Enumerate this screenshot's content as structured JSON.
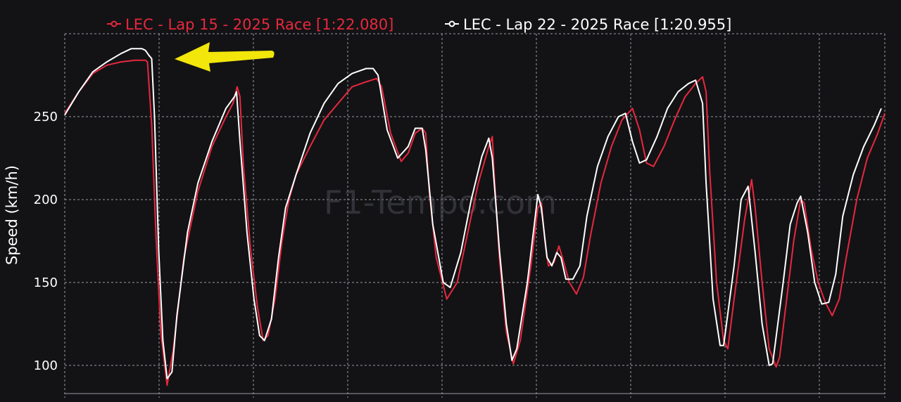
{
  "chart_data": {
    "type": "line",
    "xlabel": "",
    "ylabel": "Speed (km/h)",
    "ylim": [
      83,
      300
    ],
    "xlim": [
      0,
      1
    ],
    "yticks": [
      100,
      150,
      200,
      250
    ],
    "grid": true,
    "legend_position": "top",
    "watermark": "F1-Tempo.com",
    "series": [
      {
        "name": "LEC - Lap 15 - 2025 Race [1:22.080]",
        "color": "#e8283c",
        "points": [
          [
            0,
            252
          ],
          [
            0.02,
            265
          ],
          [
            0.04,
            276
          ],
          [
            0.06,
            281
          ],
          [
            0.08,
            283
          ],
          [
            0.1,
            284
          ],
          [
            0.115,
            284
          ],
          [
            0.118,
            283
          ],
          [
            0.124,
            245
          ],
          [
            0.13,
            180
          ],
          [
            0.137,
            120
          ],
          [
            0.146,
            88
          ],
          [
            0.155,
            110
          ],
          [
            0.17,
            165
          ],
          [
            0.19,
            205
          ],
          [
            0.21,
            232
          ],
          [
            0.23,
            250
          ],
          [
            0.24,
            258
          ],
          [
            0.246,
            268
          ],
          [
            0.25,
            262
          ],
          [
            0.255,
            220
          ],
          [
            0.265,
            170
          ],
          [
            0.275,
            135
          ],
          [
            0.283,
            115
          ],
          [
            0.29,
            118
          ],
          [
            0.3,
            140
          ],
          [
            0.31,
            175
          ],
          [
            0.32,
            200
          ],
          [
            0.33,
            215
          ],
          [
            0.35,
            232
          ],
          [
            0.37,
            248
          ],
          [
            0.39,
            258
          ],
          [
            0.41,
            268
          ],
          [
            0.43,
            271
          ],
          [
            0.445,
            273
          ],
          [
            0.452,
            268
          ],
          [
            0.465,
            240
          ],
          [
            0.48,
            223
          ],
          [
            0.49,
            228
          ],
          [
            0.5,
            240
          ],
          [
            0.51,
            243
          ],
          [
            0.515,
            240
          ],
          [
            0.52,
            205
          ],
          [
            0.53,
            165
          ],
          [
            0.545,
            140
          ],
          [
            0.56,
            150
          ],
          [
            0.575,
            180
          ],
          [
            0.59,
            210
          ],
          [
            0.605,
            232
          ],
          [
            0.61,
            238
          ],
          [
            0.612,
            220
          ],
          [
            0.62,
            165
          ],
          [
            0.63,
            120
          ],
          [
            0.64,
            101
          ],
          [
            0.65,
            115
          ],
          [
            0.665,
            160
          ],
          [
            0.675,
            195
          ],
          [
            0.68,
            198
          ],
          [
            0.685,
            175
          ],
          [
            0.69,
            160
          ],
          [
            0.698,
            162
          ],
          [
            0.705,
            172
          ],
          [
            0.71,
            165
          ],
          [
            0.72,
            150
          ],
          [
            0.73,
            143
          ],
          [
            0.74,
            153
          ],
          [
            0.75,
            178
          ],
          [
            0.765,
            210
          ],
          [
            0.78,
            232
          ],
          [
            0.795,
            248
          ],
          [
            0.81,
            255
          ],
          [
            0.82,
            242
          ],
          [
            0.83,
            222
          ],
          [
            0.84,
            220
          ],
          [
            0.855,
            232
          ],
          [
            0.87,
            248
          ],
          [
            0.885,
            262
          ],
          [
            0.9,
            270
          ],
          [
            0.91,
            274
          ],
          [
            0.915,
            265
          ],
          [
            0.92,
            218
          ],
          [
            0.93,
            150
          ],
          [
            0.94,
            115
          ],
          [
            0.946,
            110
          ],
          [
            0.955,
            140
          ],
          [
            0.97,
            188
          ],
          [
            0.98,
            212
          ],
          [
            0.985,
            195
          ],
          [
            0.995,
            150
          ],
          [
            1.005,
            110
          ],
          [
            1.015,
            99
          ],
          [
            1.02,
            105
          ],
          [
            1.03,
            140
          ],
          [
            1.04,
            175
          ],
          [
            1.05,
            200
          ],
          [
            1.055,
            198
          ],
          [
            1.065,
            170
          ],
          [
            1.075,
            150
          ],
          [
            1.085,
            138
          ],
          [
            1.095,
            130
          ],
          [
            1.105,
            140
          ],
          [
            1.115,
            165
          ],
          [
            1.13,
            200
          ],
          [
            1.145,
            225
          ],
          [
            1.16,
            240
          ],
          [
            1.17,
            252
          ]
        ]
      },
      {
        "name": "LEC - Lap 22 - 2025 Race [1:20.955]",
        "color": "#ffffff",
        "points": [
          [
            0,
            251
          ],
          [
            0.02,
            265
          ],
          [
            0.04,
            277
          ],
          [
            0.06,
            283
          ],
          [
            0.08,
            288
          ],
          [
            0.095,
            291
          ],
          [
            0.11,
            291
          ],
          [
            0.115,
            290
          ],
          [
            0.12,
            287
          ],
          [
            0.124,
            285
          ],
          [
            0.128,
            250
          ],
          [
            0.134,
            170
          ],
          [
            0.14,
            115
          ],
          [
            0.146,
            92
          ],
          [
            0.153,
            96
          ],
          [
            0.16,
            130
          ],
          [
            0.175,
            180
          ],
          [
            0.19,
            210
          ],
          [
            0.21,
            235
          ],
          [
            0.23,
            255
          ],
          [
            0.242,
            262
          ],
          [
            0.245,
            265
          ],
          [
            0.25,
            235
          ],
          [
            0.26,
            180
          ],
          [
            0.27,
            140
          ],
          [
            0.278,
            118
          ],
          [
            0.285,
            115
          ],
          [
            0.295,
            128
          ],
          [
            0.305,
            165
          ],
          [
            0.315,
            195
          ],
          [
            0.33,
            215
          ],
          [
            0.35,
            240
          ],
          [
            0.37,
            258
          ],
          [
            0.39,
            270
          ],
          [
            0.41,
            276
          ],
          [
            0.43,
            279
          ],
          [
            0.44,
            279
          ],
          [
            0.447,
            275
          ],
          [
            0.46,
            242
          ],
          [
            0.475,
            225
          ],
          [
            0.49,
            232
          ],
          [
            0.5,
            243
          ],
          [
            0.51,
            243
          ],
          [
            0.515,
            230
          ],
          [
            0.525,
            185
          ],
          [
            0.54,
            150
          ],
          [
            0.55,
            147
          ],
          [
            0.565,
            168
          ],
          [
            0.58,
            200
          ],
          [
            0.595,
            226
          ],
          [
            0.605,
            237
          ],
          [
            0.61,
            225
          ],
          [
            0.62,
            170
          ],
          [
            0.63,
            125
          ],
          [
            0.638,
            103
          ],
          [
            0.645,
            110
          ],
          [
            0.66,
            150
          ],
          [
            0.67,
            185
          ],
          [
            0.675,
            203
          ],
          [
            0.68,
            195
          ],
          [
            0.688,
            165
          ],
          [
            0.695,
            160
          ],
          [
            0.702,
            168
          ],
          [
            0.708,
            165
          ],
          [
            0.715,
            152
          ],
          [
            0.725,
            152
          ],
          [
            0.735,
            160
          ],
          [
            0.745,
            190
          ],
          [
            0.76,
            220
          ],
          [
            0.775,
            238
          ],
          [
            0.79,
            250
          ],
          [
            0.8,
            252
          ],
          [
            0.81,
            235
          ],
          [
            0.82,
            222
          ],
          [
            0.83,
            224
          ],
          [
            0.845,
            238
          ],
          [
            0.86,
            255
          ],
          [
            0.875,
            265
          ],
          [
            0.89,
            270
          ],
          [
            0.9,
            272
          ],
          [
            0.91,
            258
          ],
          [
            0.915,
            210
          ],
          [
            0.925,
            140
          ],
          [
            0.935,
            112
          ],
          [
            0.94,
            112
          ],
          [
            0.955,
            160
          ],
          [
            0.965,
            200
          ],
          [
            0.975,
            208
          ],
          [
            0.985,
            168
          ],
          [
            0.995,
            125
          ],
          [
            1.005,
            100
          ],
          [
            1.01,
            101
          ],
          [
            1.025,
            150
          ],
          [
            1.035,
            185
          ],
          [
            1.045,
            198
          ],
          [
            1.05,
            202
          ],
          [
            1.06,
            180
          ],
          [
            1.07,
            150
          ],
          [
            1.08,
            137
          ],
          [
            1.09,
            138
          ],
          [
            1.1,
            155
          ],
          [
            1.11,
            190
          ],
          [
            1.125,
            215
          ],
          [
            1.14,
            232
          ],
          [
            1.155,
            245
          ],
          [
            1.165,
            255
          ]
        ]
      }
    ]
  }
}
